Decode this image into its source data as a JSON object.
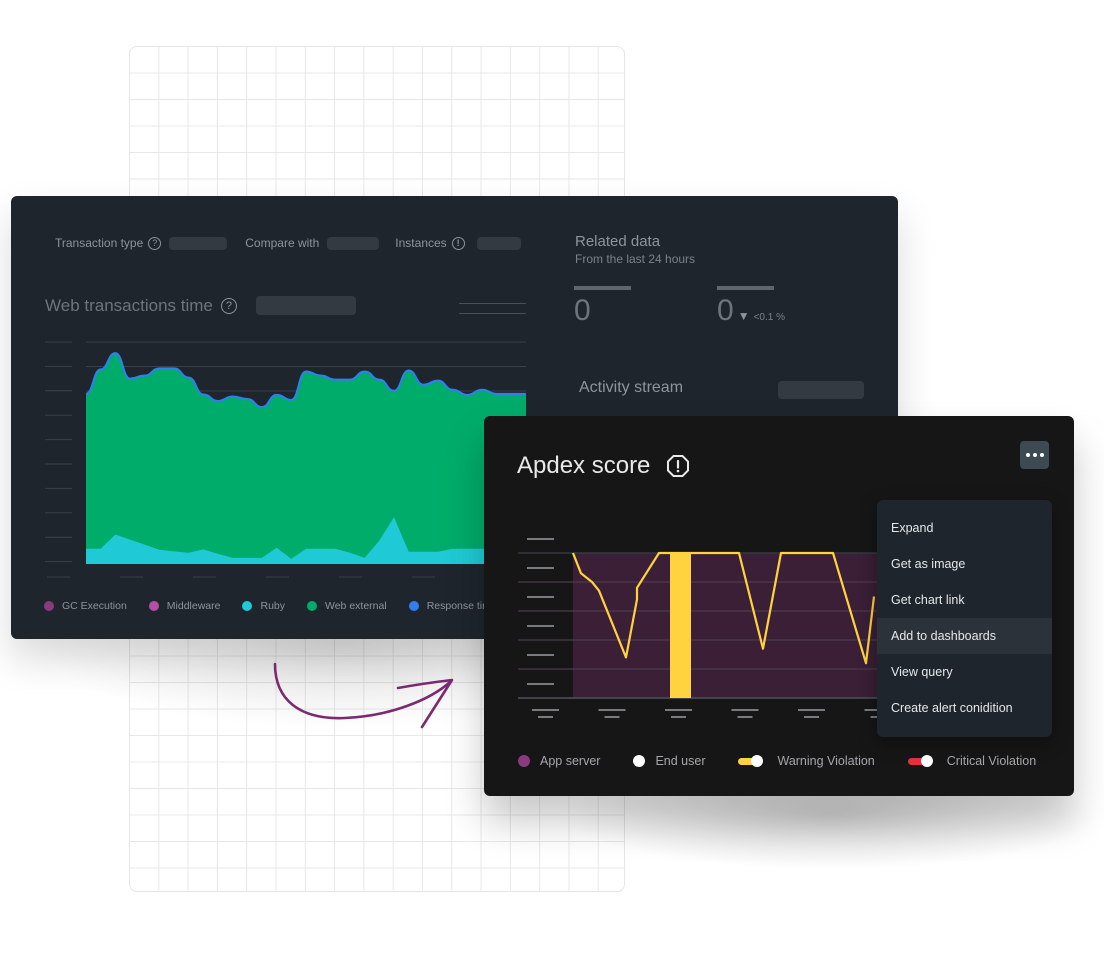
{
  "back_panel": {
    "filters": [
      {
        "label": "Transaction type",
        "icon": "help-circle-icon",
        "value": ""
      },
      {
        "label": "Compare with",
        "icon": null,
        "value": ""
      },
      {
        "label": "Instances",
        "icon": "alert-circle-icon",
        "value": ""
      }
    ],
    "chart_title": "Web transactions time",
    "related": {
      "title": "Related data",
      "subtitle": "From the last 24 hours",
      "stats": [
        {
          "value": "0"
        },
        {
          "value": "0",
          "trend": "down",
          "delta": "<0.1 %"
        }
      ]
    },
    "activity_title": "Activity stream",
    "legend": [
      {
        "label": "GC Execution",
        "color": "#8b3a7e"
      },
      {
        "label": "Middleware",
        "color": "#b44fa6"
      },
      {
        "label": "Ruby",
        "color": "#1fc9d6"
      },
      {
        "label": "Web external",
        "color": "#00ac69"
      },
      {
        "label": "Response time",
        "color": "#2f80ed"
      }
    ]
  },
  "front_panel": {
    "title": "Apdex score",
    "title_icon": "alert-octagon-icon",
    "more_button": "more-options-icon",
    "menu": {
      "items": [
        "Expand",
        "Get as image",
        "Get chart link",
        "Add to dashboards",
        "View query",
        "Create alert conidition"
      ],
      "highlighted": "Add to dashboards"
    },
    "legend": [
      {
        "label": "App server",
        "type": "dot",
        "color": "#8b3a7e"
      },
      {
        "label": "End user",
        "type": "dot",
        "color": "#ffffff"
      },
      {
        "label": "Warning Violation",
        "type": "toggle",
        "color": "#ffd23f"
      },
      {
        "label": "Critical Violation",
        "type": "toggle",
        "color": "#e8303d"
      }
    ]
  },
  "chart_data": [
    {
      "type": "area",
      "title": "Web transactions time",
      "x": [
        0,
        1,
        2,
        3,
        4,
        5,
        6,
        7,
        8,
        9,
        10,
        11,
        12,
        13,
        14,
        15,
        16,
        17,
        18,
        19,
        20,
        21,
        22,
        23,
        24,
        25,
        26,
        27,
        28,
        29,
        30
      ],
      "series": [
        {
          "name": "Ruby",
          "color": "#1fc9d6",
          "values": [
            0.75,
            0.75,
            1.45,
            1.2,
            0.95,
            0.7,
            0.62,
            0.55,
            0.72,
            0.5,
            0.3,
            0.3,
            0.3,
            0.8,
            0.25,
            0.75,
            0.75,
            0.75,
            0.55,
            0.3,
            1.15,
            2.3,
            0.6,
            0.6,
            0.6,
            0.75,
            0.75,
            0.75,
            0.75,
            0.75,
            0.75
          ]
        },
        {
          "name": "Web external",
          "color": "#00ac69",
          "values": [
            7.6,
            8.8,
            8.9,
            7.9,
            8.3,
            8.9,
            8.9,
            8.6,
            7.6,
            7.4,
            7.5,
            7.6,
            7.4,
            7.5,
            7.8,
            8.7,
            8.5,
            8.3,
            8.5,
            8.7,
            7.9,
            7.2,
            8.9,
            8.2,
            8.4,
            7.8,
            7.5,
            7.8,
            7.6,
            7.6,
            7.6
          ]
        },
        {
          "name": "Response time",
          "color": "#2f80ed",
          "values": [
            8.35,
            9.55,
            10.35,
            9.1,
            9.25,
            9.6,
            9.6,
            9.15,
            8.32,
            8.0,
            8.22,
            8.1,
            7.7,
            8.3,
            8.05,
            9.45,
            9.25,
            9.05,
            9.05,
            9.45,
            9.05,
            8.5,
            9.5,
            8.8,
            9.0,
            8.55,
            8.3,
            8.55,
            8.35,
            8.35,
            8.35
          ]
        }
      ],
      "ylim": [
        0,
        11
      ],
      "grid": true,
      "legend": "bottom"
    },
    {
      "type": "line",
      "title": "Apdex score",
      "x": [
        0,
        1,
        2,
        3,
        4,
        5,
        6,
        7,
        8,
        9,
        10,
        11,
        12,
        13,
        14,
        15,
        16,
        17,
        18,
        19,
        20
      ],
      "series": [
        {
          "name": "Apdex",
          "color": "#ffd23f",
          "values": [
            1.0,
            0.93,
            0.9,
            0.76,
            0.88,
            1.0,
            1.0,
            1.0,
            1.0,
            1.0,
            1.0,
            0.82,
            1.0,
            1.0,
            1.0,
            1.0,
            0.76,
            0.95,
            1.0,
            1.0,
            1.0
          ]
        }
      ],
      "violation_band": {
        "name": "Warning Violation",
        "color": "#ffd23f",
        "x_range": [
          6.5,
          7.5
        ]
      },
      "shaded_region": {
        "name": "App server",
        "color": "#3a1f36"
      },
      "ylim": [
        0.5,
        1.0
      ],
      "grid": true,
      "legend": "bottom"
    }
  ]
}
